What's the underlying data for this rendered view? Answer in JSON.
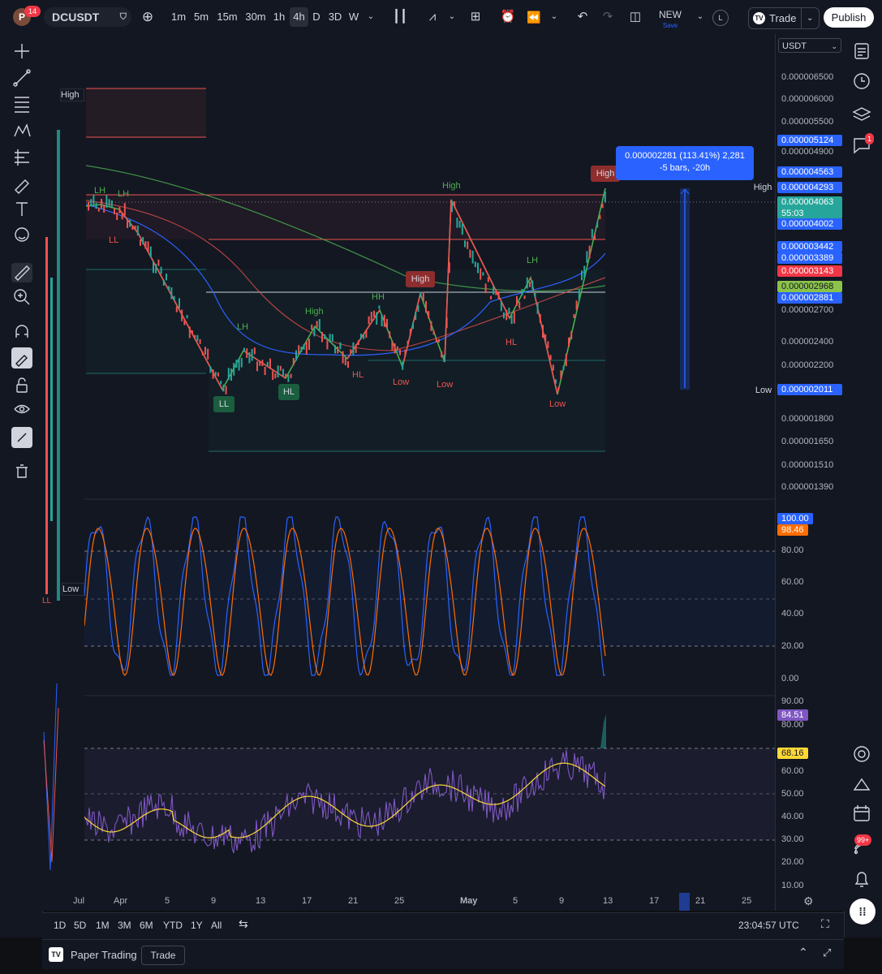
{
  "topbar": {
    "avatar_letter": "P",
    "notifications": "14",
    "symbol": "DCUSDT",
    "intervals": [
      "1m",
      "5m",
      "15m",
      "30m",
      "1h",
      "4h",
      "D",
      "3D",
      "W"
    ],
    "active_interval": "4h",
    "layout_name": "NEW",
    "layout_status": "Save",
    "layout_avatar": "L",
    "trade_label": "Trade",
    "publish_label": "Publish"
  },
  "currency_select": "USDT",
  "price_ticks": [
    "0.000006500",
    "0.000006000",
    "0.000005500",
    "0.000004900",
    "0.000002700",
    "0.000002400",
    "0.000002200",
    "0.000001800",
    "0.000001650",
    "0.000001510",
    "0.000001390"
  ],
  "price_pills": {
    "p5124": "0.000005124",
    "p4563": "0.000004563",
    "p4293": "0.000004293",
    "p4063": "0.000004063",
    "countdown": "55:03",
    "p4002": "0.000004002",
    "p3442": "0.000003442",
    "p3389": "0.000003389",
    "p3143": "0.000003143",
    "p2968": "0.000002968",
    "p2881": "0.000002881",
    "p2011": "0.000002011",
    "high_tag": "High",
    "low_tag": "Low"
  },
  "measure_tooltip": {
    "line1": "0.000002281 (113.41%) 2,281",
    "line2": "-5 bars, -20h"
  },
  "swing_labels": {
    "lh1": "LH",
    "lh2": "LH",
    "ll1": "LL",
    "ll_box": "LL",
    "lh3": "LH",
    "hl_box": "HL",
    "high1": "High",
    "hl1": "HL",
    "hh": "HH",
    "low1": "Low",
    "high_box": "High",
    "low2": "Low",
    "high2": "High",
    "lh4": "LH",
    "hl2": "HL",
    "low3": "Low",
    "high_box2": "High"
  },
  "left_strip": {
    "high": "High",
    "low": "Low",
    "ll": "LL"
  },
  "osc_ticks": [
    "80.00",
    "60.00",
    "40.00",
    "20.00",
    "0.00"
  ],
  "osc_pills": {
    "k": "100.00",
    "d": "98.46"
  },
  "rsi_ticks": [
    "90.00",
    "80.00",
    "60.00",
    "50.00",
    "40.00",
    "30.00",
    "20.00",
    "10.00"
  ],
  "rsi_pills": {
    "rsi": "84.51",
    "ma": "68.16"
  },
  "time_ticks": [
    "Jul",
    "Apr",
    "5",
    "9",
    "13",
    "17",
    "21",
    "25",
    "May",
    "5",
    "9",
    "13",
    "17",
    "21",
    "25"
  ],
  "ranges": [
    "1D",
    "5D",
    "1M",
    "3M",
    "6M",
    "YTD",
    "1Y",
    "All"
  ],
  "clock": "23:04:57 UTC",
  "status": {
    "app": "Paper Trading",
    "trade": "Trade"
  },
  "right_badges": {
    "chat": "1",
    "feed": "99+"
  },
  "colors": {
    "up": "#26a69a",
    "down": "#ef5350",
    "accent": "#2962ff",
    "k_line": "#2962ff",
    "d_line": "#ff6d00",
    "rsi": "#7e57c2",
    "rsi_ma": "#fdd835"
  }
}
